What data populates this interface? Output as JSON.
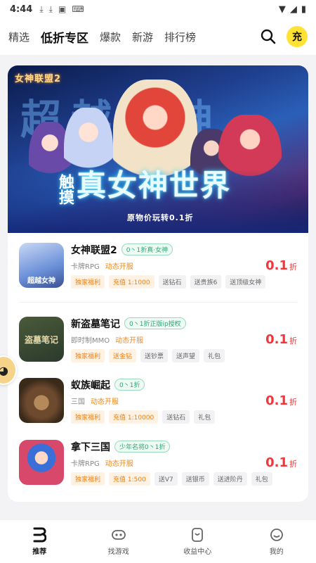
{
  "status_bar": {
    "time": "4:44"
  },
  "top_nav": {
    "tabs": [
      {
        "label": "精选",
        "active": false
      },
      {
        "label": "低折专区",
        "active": true
      },
      {
        "label": "爆款",
        "active": false
      },
      {
        "label": "新游",
        "active": false
      },
      {
        "label": "排行榜",
        "active": false
      }
    ],
    "charge_label": "充"
  },
  "banner": {
    "logo": "女神联盟2",
    "bg_title": "超越女神",
    "headline_side": "触摸",
    "headline": "真女神世界",
    "subline": "原物价玩转0.1折"
  },
  "games": [
    {
      "name": "女神联盟2",
      "highlight": "0丶1折真·女神",
      "genre": "卡牌RPG",
      "server": "动态开服",
      "tags": [
        "独家福利",
        "充值 1:1000",
        "送钻石",
        "送贵族6",
        "送顶级女神"
      ],
      "discount": "0.1",
      "unit": "折",
      "icon_text": "超越女神",
      "icon_color": "#6a8fd8"
    },
    {
      "name": "新盗墓笔记",
      "highlight": "0丶1折正版ip授权",
      "genre": "即时制MMO",
      "server": "动态开服",
      "tags": [
        "独家福利",
        "送金钻",
        "送钞票",
        "送声望",
        "礼包"
      ],
      "discount": "0.1",
      "unit": "折",
      "icon_text": "盗墓笔记",
      "icon_color": "#2b3a2c"
    },
    {
      "name": "蚁族崛起",
      "highlight": "0丶1折",
      "genre": "三国",
      "server": "动态开服",
      "tags": [
        "独家福利",
        "充值 1:10000",
        "送钻石",
        "礼包"
      ],
      "discount": "0.1",
      "unit": "折",
      "icon_text": "",
      "icon_color": "#8a5a3a"
    },
    {
      "name": "拿下三国",
      "highlight": "少年名将0丶1折",
      "genre": "卡牌RPG",
      "server": "动态开服",
      "tags": [
        "独家福利",
        "充值 1:500",
        "送V7",
        "送银币",
        "送进阶丹",
        "礼包"
      ],
      "discount": "0.1",
      "unit": "折",
      "icon_text": "",
      "icon_color": "#d8486a"
    }
  ],
  "bottom_nav": [
    {
      "label": "推荐",
      "icon": "home-b-icon",
      "active": true
    },
    {
      "label": "找游戏",
      "icon": "gamepad-icon",
      "active": false
    },
    {
      "label": "收益中心",
      "icon": "wallet-icon",
      "active": false
    },
    {
      "label": "我的",
      "icon": "profile-icon",
      "active": false
    }
  ]
}
